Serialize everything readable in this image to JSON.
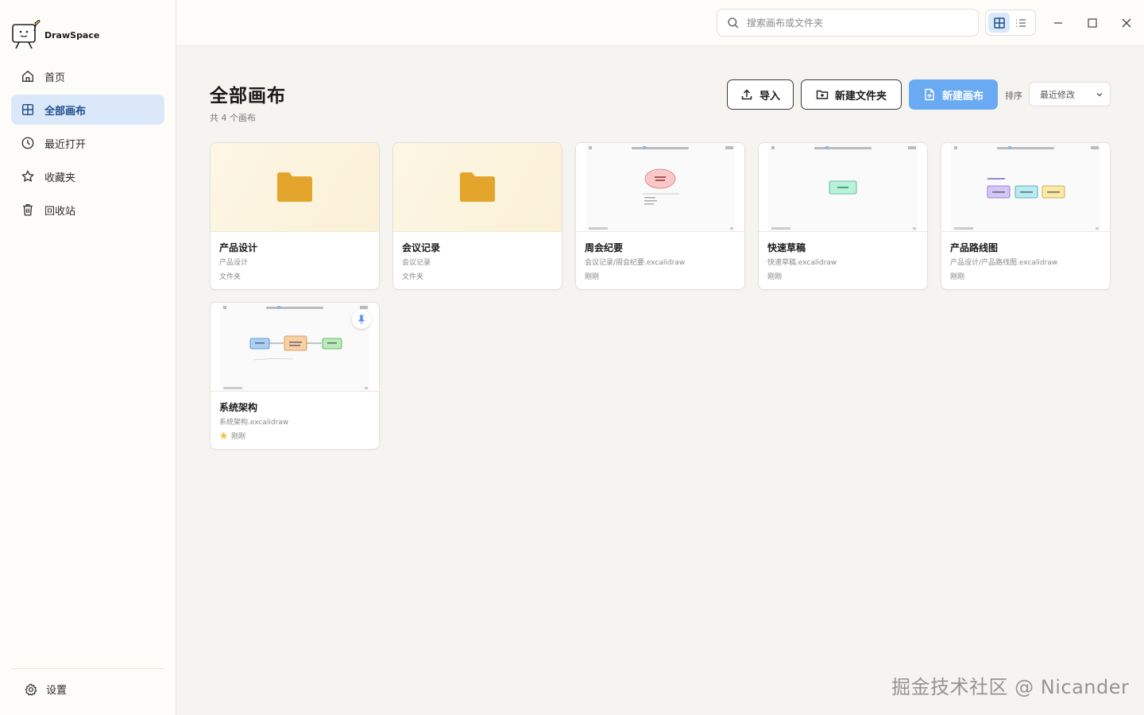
{
  "app": {
    "name": "DrawSpace"
  },
  "sidebar": {
    "items": [
      {
        "label": "首页",
        "icon": "home-icon",
        "active": false
      },
      {
        "label": "全部画布",
        "icon": "grid-icon",
        "active": true
      },
      {
        "label": "最近打开",
        "icon": "clock-icon",
        "active": false
      },
      {
        "label": "收藏夹",
        "icon": "star-icon",
        "active": false
      },
      {
        "label": "回收站",
        "icon": "trash-icon",
        "active": false
      }
    ],
    "settings_label": "设置"
  },
  "topbar": {
    "search_placeholder": "搜索画布或文件夹",
    "view_mode": "grid"
  },
  "main": {
    "title": "全部画布",
    "count_text": "共 4 个画布",
    "import_label": "导入",
    "new_folder_label": "新建文件夹",
    "new_canvas_label": "新建画布",
    "sort_label": "排序",
    "sort_value": "最近修改"
  },
  "cards": [
    {
      "title": "产品设计",
      "path": "产品设计",
      "meta": "文件夹",
      "kind": "folder"
    },
    {
      "title": "会议记录",
      "path": "会议记录",
      "meta": "文件夹",
      "kind": "folder"
    },
    {
      "title": "周会纪要",
      "path": "会议记录/周会纪要.excalidraw",
      "meta": "刚刚",
      "kind": "canvas"
    },
    {
      "title": "快速草稿",
      "path": "快速草稿.excalidraw",
      "meta": "刚刚",
      "kind": "canvas"
    },
    {
      "title": "产品路线图",
      "path": "产品设计/产品路线图.excalidraw",
      "meta": "刚刚",
      "kind": "canvas"
    },
    {
      "title": "系统架构",
      "path": "系统架构.excalidraw",
      "meta": "刚刚",
      "kind": "canvas",
      "favorite": true,
      "pinned": true
    }
  ],
  "colors": {
    "accent": "#6aaaf2",
    "active_nav_bg": "#dbe8f9",
    "active_nav_text": "#1f4d8c",
    "folder": "#e3a52b",
    "star": "#f5c04a"
  },
  "watermark": "掘金技术社区 @ Nicander"
}
